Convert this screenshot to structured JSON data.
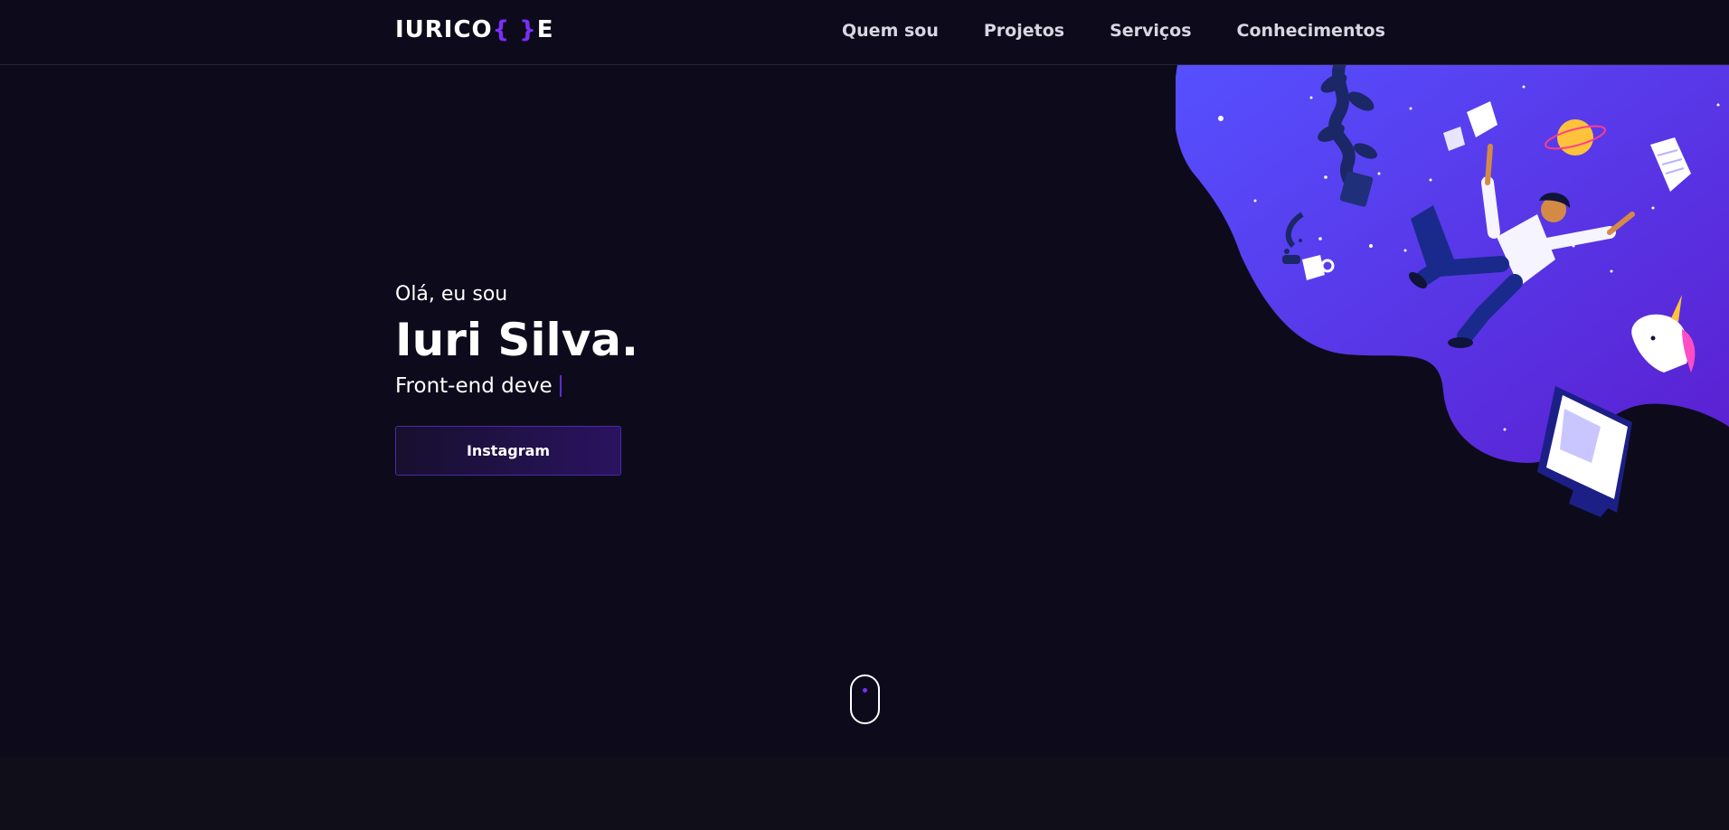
{
  "logo": {
    "prefix": "IURICO",
    "brace_open": "{",
    "brace_close": "}",
    "suffix": "E"
  },
  "nav": {
    "items": [
      {
        "label": "Quem sou"
      },
      {
        "label": "Projetos"
      },
      {
        "label": "Serviços"
      },
      {
        "label": "Conhecimentos"
      }
    ]
  },
  "hero": {
    "greeting": "Olá, eu sou",
    "name": "Iuri Silva.",
    "role": "Front-end deve"
  },
  "cta": {
    "label": "Instagram"
  },
  "colors": {
    "background": "#0d0b1b",
    "accent": "#7b2ff7",
    "illustration_blue": "#4f46ff"
  },
  "icons": {
    "scroll": "mouse-scroll-icon"
  }
}
